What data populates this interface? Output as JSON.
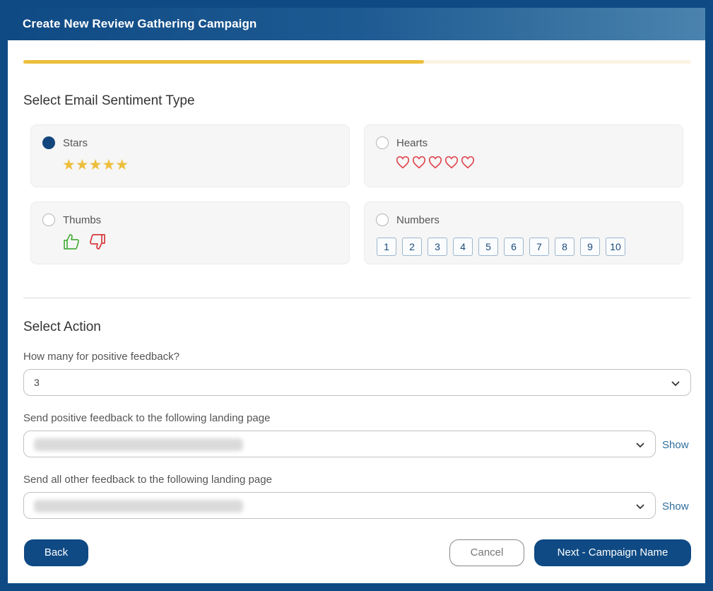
{
  "modal": {
    "title": "Create New Review Gathering Campaign"
  },
  "progress": {
    "fraction": 0.6
  },
  "sentiment": {
    "section_title": "Select Email Sentiment Type",
    "options": [
      {
        "label": "Stars",
        "selected": true,
        "icon": "star-icon"
      },
      {
        "label": "Hearts",
        "selected": false,
        "icon": "heart-outline-icon"
      },
      {
        "label": "Thumbs",
        "selected": false,
        "icon": "thumbs-up-down-icon"
      },
      {
        "label": "Numbers",
        "selected": false
      }
    ],
    "star_glyphs": "★★★★★",
    "numbers": [
      "1",
      "2",
      "3",
      "4",
      "5",
      "6",
      "7",
      "8",
      "9",
      "10"
    ]
  },
  "action": {
    "section_title": "Select Action",
    "positive_count_label": "How many for positive feedback?",
    "positive_count_value": "3",
    "positive_page_label": "Send positive feedback to the following landing page",
    "other_page_label": "Send all other feedback to the following landing page",
    "show_label": "Show"
  },
  "footer": {
    "back_label": "Back",
    "cancel_label": "Cancel",
    "next_label": "Next - Campaign Name"
  },
  "colors": {
    "brand_blue": "#0f4a84",
    "accent_yellow": "#ecbe3b",
    "heart_red": "#e0464f",
    "thumb_green": "#4bae3f",
    "thumb_red": "#d6383b"
  }
}
